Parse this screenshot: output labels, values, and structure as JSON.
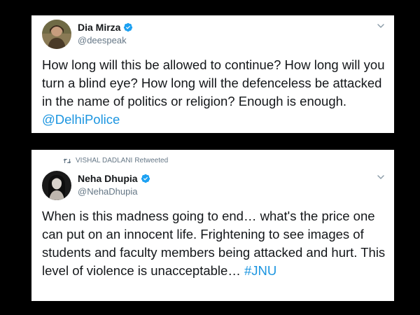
{
  "tweets": [
    {
      "display_name": "Dia Mirza",
      "handle": "@deespeak",
      "verified": true,
      "avatar_icon": "user-avatar-photo",
      "text": "How long will this be allowed to continue? How long will you turn a blind eye? How long will the defenceless be attacked in the name of politics or religion? Enough is enough. ",
      "mention": "@DelhiPolice"
    },
    {
      "retweet_context": {
        "icon": "retweet-icon",
        "user": "VISHAL DADLANI",
        "suffix": "Retweeted"
      },
      "display_name": "Neha Dhupia",
      "handle": "@NehaDhupia",
      "verified": true,
      "avatar_icon": "user-avatar-photo",
      "text": "When is this madness going to end… what's the price one can put on an innocent life. Frightening to see images of students and faculty members being attacked and hurt. This level of violence is unacceptable… ",
      "hashtag": "#JNU"
    }
  ],
  "colors": {
    "background": "#000000",
    "card": "#ffffff",
    "text_primary": "#14171a",
    "text_secondary": "#657786",
    "link": "#1b95e0",
    "verified_badge": "#1da1f2"
  }
}
